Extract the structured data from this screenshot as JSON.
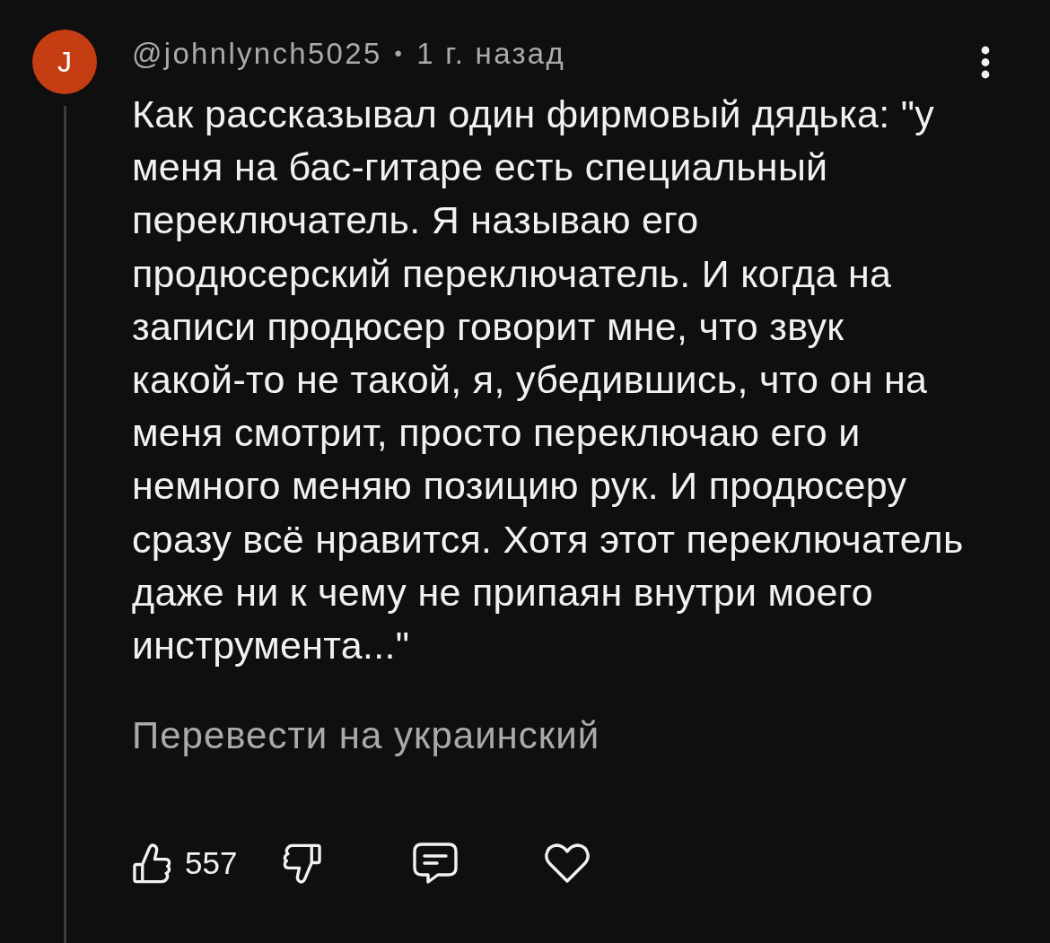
{
  "comment": {
    "avatar": {
      "initial": "J"
    },
    "author": "@johnlynch5025",
    "separator": "•",
    "time": "1 г. назад",
    "text": "Как рассказывал один фирмовый дядька: \"у меня на бас-гитаре есть специальный переключатель. Я называю его продюсерский переключатель. И когда на записи продюсер говорит мне, что звук какой-то не такой, я, убедившись, что он на меня смотрит, просто переключаю его и немного меняю позицию рук. И продюсеру сразу всё нравится. Хотя этот переключатель даже ни к чему не припаян внутри моего инструмента...\"",
    "translate_link": "Перевести на украинский",
    "actions": [
      {
        "kind": "like",
        "count": "557"
      },
      {
        "kind": "dislike"
      },
      {
        "kind": "reply"
      },
      {
        "kind": "heart"
      }
    ]
  }
}
